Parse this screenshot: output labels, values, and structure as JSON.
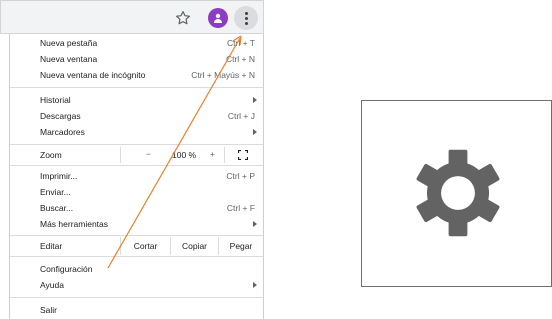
{
  "menu": {
    "new_tab": {
      "label": "Nueva pestaña",
      "shortcut": "Ctrl + T"
    },
    "new_window": {
      "label": "Nueva ventana",
      "shortcut": "Ctrl + N"
    },
    "incognito": {
      "label": "Nueva ventana de incógnito",
      "shortcut": "Ctrl + Mayús + N"
    },
    "history": {
      "label": "Historial"
    },
    "downloads": {
      "label": "Descargas",
      "shortcut": "Ctrl + J"
    },
    "bookmarks": {
      "label": "Marcadores"
    },
    "zoom": {
      "label": "Zoom",
      "minus": "−",
      "level": "100 %",
      "plus": "+"
    },
    "print": {
      "label": "Imprimir...",
      "shortcut": "Ctrl + P"
    },
    "send": {
      "label": "Enviar..."
    },
    "find": {
      "label": "Buscar...",
      "shortcut": "Ctrl + F"
    },
    "more_tools": {
      "label": "Más herramientas"
    },
    "edit": {
      "label": "Editar",
      "cut": "Cortar",
      "copy": "Copiar",
      "paste": "Pegar"
    },
    "settings": {
      "label": "Configuración"
    },
    "help": {
      "label": "Ayuda"
    },
    "exit": {
      "label": "Salir"
    }
  },
  "icons": {
    "star": "star-icon",
    "profile": "profile-avatar-icon",
    "menu": "three-dot-menu-icon",
    "gear": "gear-icon",
    "fullscreen": "fullscreen-icon"
  },
  "colors": {
    "annotation_arrow": "#f07d2a",
    "profile_avatar": "#8e3cc2",
    "gear": "#636363"
  }
}
